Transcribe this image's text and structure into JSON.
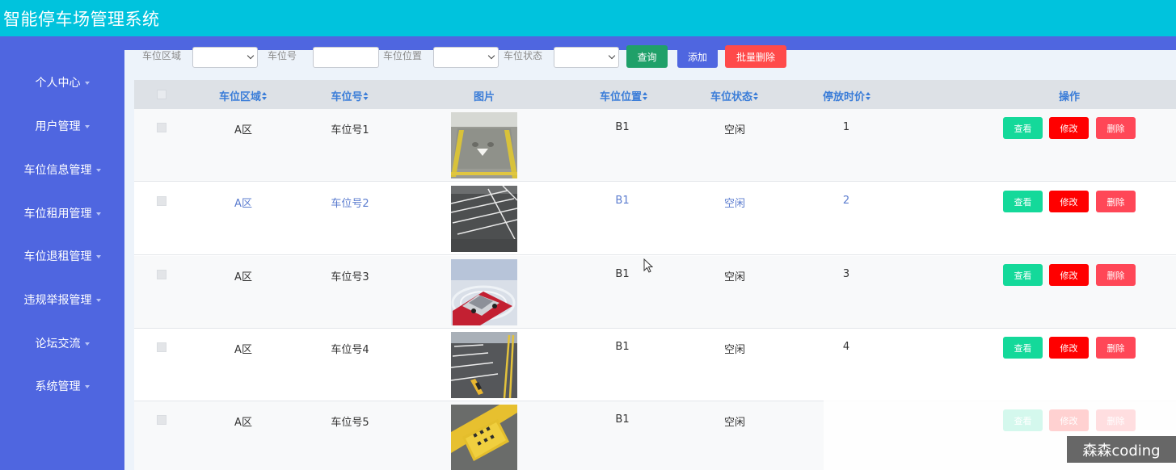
{
  "app": {
    "title": "智能停车场管理系统"
  },
  "sidebar": {
    "items": [
      {
        "label": "个人中心"
      },
      {
        "label": "用户管理"
      },
      {
        "label": "车位信息管理"
      },
      {
        "label": "车位租用管理"
      },
      {
        "label": "车位退租管理"
      },
      {
        "label": "违规举报管理"
      },
      {
        "label": "论坛交流"
      },
      {
        "label": "系统管理"
      }
    ]
  },
  "search": {
    "area_label": "车位区域",
    "area_value": "",
    "number_label": "车位号",
    "number_value": "",
    "location_label": "车位位置",
    "location_value": "",
    "status_label": "车位状态",
    "status_value": "",
    "query_button": "查询",
    "add_button": "添加",
    "batch_delete_button": "批量删除"
  },
  "table": {
    "columns": {
      "area": "车位区域",
      "number": "车位号",
      "image": "图片",
      "location": "车位位置",
      "status": "车位状态",
      "price": "停放时价",
      "actions": "操作"
    },
    "rows": [
      {
        "area": "A区",
        "number": "车位号1",
        "location": "B1",
        "status": "空闲",
        "price": "1",
        "image": "parking-lot-lines-photo"
      },
      {
        "area": "A区",
        "number": "车位号2",
        "location": "B1",
        "status": "空闲",
        "price": "2",
        "image": "empty-parking-spaces-photo"
      },
      {
        "area": "A区",
        "number": "车位号3",
        "location": "B1",
        "status": "空闲",
        "price": "3",
        "image": "car-on-parking-spot-photo"
      },
      {
        "area": "A区",
        "number": "车位号4",
        "location": "B1",
        "status": "空闲",
        "price": "4",
        "image": "parking-lock-photo"
      },
      {
        "area": "A区",
        "number": "车位号5",
        "location": "B1",
        "status": "空闲",
        "price": "",
        "image": "reserved-parking-sign-photo"
      }
    ],
    "actions": {
      "view": "查看",
      "edit": "修改",
      "delete": "删除"
    }
  },
  "watermark": "森森coding",
  "colors": {
    "header": "#00c3dd",
    "sidebar": "#4f66e0",
    "view_button": "#14d99a",
    "edit_button": "#ff0000",
    "delete_button": "#ff4757",
    "query_button": "#1fa069",
    "add_button": "#4f66e0",
    "batch_delete_button": "#ff4a4a"
  }
}
